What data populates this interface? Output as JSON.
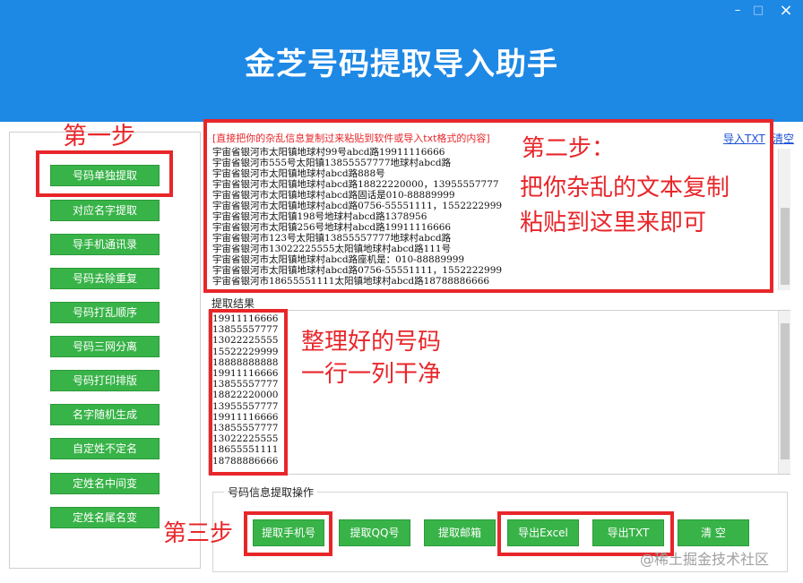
{
  "window": {
    "title": "金芝号码提取导入助手",
    "min_glyph": "–",
    "max_glyph": "□",
    "close_glyph": "×"
  },
  "sidebar": {
    "items": [
      {
        "label": "号码单独提取"
      },
      {
        "label": "对应名字提取"
      },
      {
        "label": "导手机通讯录"
      },
      {
        "label": "号码去除重复"
      },
      {
        "label": "号码打乱顺序"
      },
      {
        "label": "号码三网分离"
      },
      {
        "label": "号码打印排版"
      },
      {
        "label": "名字随机生成"
      },
      {
        "label": "自定姓不定名"
      },
      {
        "label": "定姓名中间变"
      },
      {
        "label": "定姓名尾名变"
      }
    ]
  },
  "annotations": {
    "step1": "第一步",
    "step2_line1": "第二步：",
    "step2_line2": "把你杂乱的文本复制",
    "step2_line3": "粘贴到这里来即可",
    "result_line1": "整理好的号码",
    "result_line2": "一行一列干净",
    "step3": "第三步"
  },
  "input": {
    "hint": "[直接把你的杂乱信息复制过来粘贴到软件或导入txt格式的内容]",
    "import_txt": "导入TXT",
    "clear": "清空",
    "lines": [
      "宇宙省银河市太阳镇地球村99号abcd路19911116666",
      "宇宙省银河市555号太阳镇13855557777地球村abcd路",
      "宇宙省银河市太阳镇地球村abcd路888号",
      "宇宙省银河市太阳镇地球村abcd路18822220000，13955557777",
      "宇宙省银河市太阳镇地球村abcd路固话是010-88889999",
      "宇宙省银河市太阳镇地球村abcd路0756-55551111，1552222999",
      "宇宙省银河市太阳镇198号地球村abcd路1378956",
      "宇宙省银河市太阳镇256号地球村abcd路19911116666",
      "宇宙省银河市123号太阳镇13855557777地球村abcd路",
      "宇宙省银河市13022225555太阳镇地球村abcd路111号",
      "宇宙省银河市太阳镇地球村abcd路座机是：010-88889999",
      "宇宙省银河市太阳镇地球村abcd路0756-55551111，1552222999",
      "宇宙省银河市18655551111太阳镇地球村abcd路18788886666"
    ]
  },
  "result": {
    "label": "提取结果",
    "numbers": [
      "19911116666",
      "13855557777",
      "13022225555",
      "15522229999",
      "18888888888",
      "19911116666",
      "13855557777",
      "18822220000",
      "13955557777",
      "19911116666",
      "13855557777",
      "13022225555",
      "18655551111",
      "18788886666"
    ]
  },
  "ops": {
    "title": "号码信息提取操作",
    "extract_phone": "提取手机号",
    "extract_qq": "提取QQ号",
    "extract_email": "提取邮箱",
    "export_excel": "导出Excel",
    "export_txt": "导出TXT",
    "clear": "清 空"
  },
  "watermark": "@稀土掘金技术社区",
  "colors": {
    "titlebar": "#1e88e5",
    "button_green": "#38b348",
    "annotation_red": "#e8262a",
    "link_blue": "#1a4fd6"
  }
}
